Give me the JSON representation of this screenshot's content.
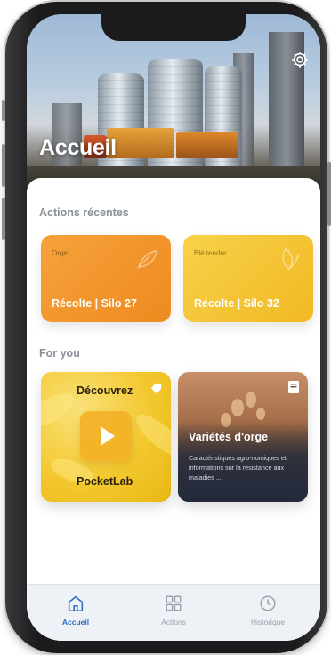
{
  "header": {
    "title": "Accueil"
  },
  "sections": {
    "recent_label": "Actions récentes",
    "foryou_label": "For you"
  },
  "recent_actions": [
    {
      "tag": "Orge",
      "title": "Récolte | Silo 27",
      "color": "#f2962a"
    },
    {
      "tag": "Blé tendre",
      "title": "Récolte | Silo 32",
      "color": "#f3c330"
    }
  ],
  "for_you": {
    "pocketlab": {
      "top": "Découvrez",
      "bottom": "PocketLab"
    },
    "article": {
      "title": "Variétés d'orge",
      "description": "Caractéristiques agro-nomiques et informations sur la résistance aux maladies ..."
    }
  },
  "tabbar": {
    "items": [
      {
        "label": "Accueil",
        "icon": "home-icon",
        "active": true
      },
      {
        "label": "Actions",
        "icon": "grid-icon",
        "active": false
      },
      {
        "label": "Historique",
        "icon": "clock-icon",
        "active": false
      }
    ]
  },
  "colors": {
    "accent": "#2e6cc6",
    "orange": "#f2962a",
    "yellow": "#f3c330"
  }
}
